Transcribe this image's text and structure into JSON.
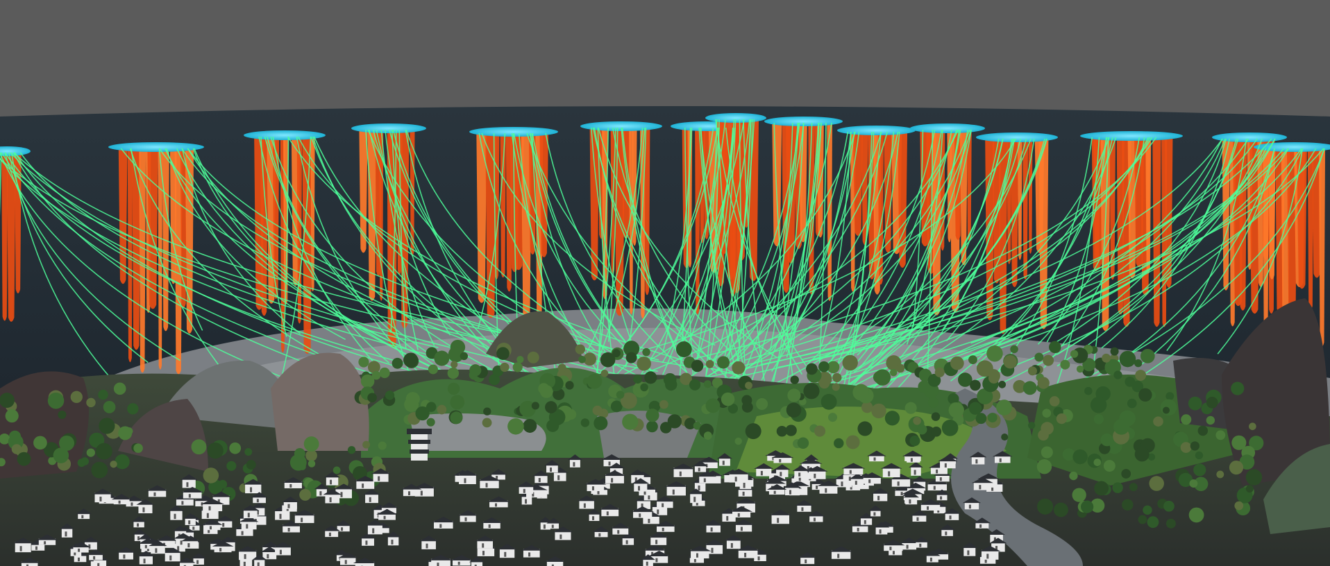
{
  "scene": {
    "kind": "3d-viewport-render",
    "colors": {
      "background": "#5b5b5b",
      "sky_band": "#27323a",
      "column_fill": "#ea4d12",
      "column_streak": "#ff7a2b",
      "column_cap": "#2fc6e6",
      "ray": "#4dff9a",
      "terrain_grass": "#3c6a32",
      "terrain_rock": "#6e6a68",
      "wall": "#7d8083",
      "roof": "#2c2f34",
      "house_wall": "#e9e9e9"
    },
    "counts": {
      "columns": 15,
      "rays_per_column": 14,
      "houses": 260
    }
  }
}
